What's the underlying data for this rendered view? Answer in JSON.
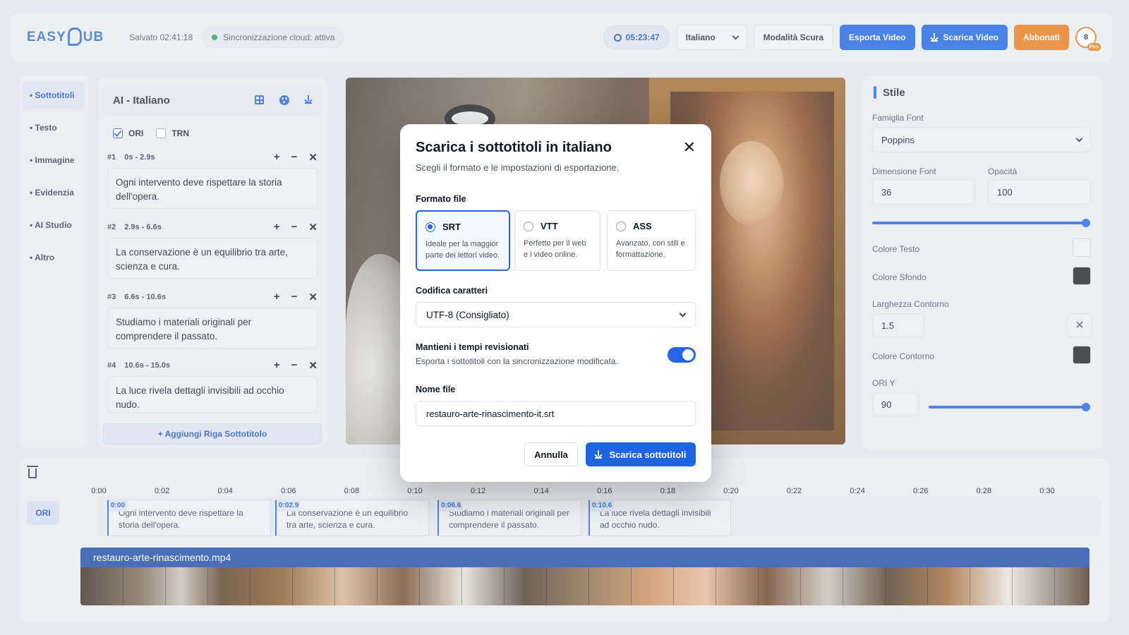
{
  "header": {
    "logo_left": "EASY",
    "logo_right": "UB",
    "saved": "Salvato 02:41:18",
    "cloud_status": "Sincronizzazione cloud: attiva",
    "timer": "05:23:47",
    "language": "Italiano",
    "dark_mode": "Modalità Scura",
    "export_video": "Esporta Video",
    "download_video": "Scarica Video",
    "subscribe": "Abbonati",
    "avatar_count": "8",
    "avatar_badge": "Pro"
  },
  "nav": {
    "items": [
      {
        "label": "• Sottotitoli"
      },
      {
        "label": "• Testo"
      },
      {
        "label": "• Immagine"
      },
      {
        "label": "• Evidenzia"
      },
      {
        "label": "• AI Studio"
      },
      {
        "label": "• Altro"
      }
    ]
  },
  "subtitles": {
    "title": "AI - Italiano",
    "ori_label": "ORI",
    "trn_label": "TRN",
    "cues": [
      {
        "num": "#1",
        "range": "0s - 2.9s",
        "text": "Ogni intervento deve rispettare la storia dell'opera."
      },
      {
        "num": "#2",
        "range": "2.9s - 6.6s",
        "text": "La conservazione è un equilibrio tra arte, scienza e cura."
      },
      {
        "num": "#3",
        "range": "6.6s - 10.6s",
        "text": "Studiamo i materiali originali per comprendere il passato."
      },
      {
        "num": "#4",
        "range": "10.6s - 15.0s",
        "text": "La luce rivela dettagli invisibili ad occhio nudo."
      }
    ],
    "add_row": "+ Aggiungi Riga Sottotitolo",
    "ctrl_plus": "+",
    "ctrl_minus": "−",
    "ctrl_close": "✕"
  },
  "style_panel": {
    "title": "Stile",
    "font_family_label": "Famiglia Font",
    "font_family": "Poppins",
    "font_size_label": "Dimensione Font",
    "font_size": "36",
    "opacity_label": "Opacità",
    "opacity": "100",
    "text_color_label": "Colore Testo",
    "bg_color_label": "Colore Sfondo",
    "outline_width_label": "Larghezza Contorno",
    "outline_width": "1.5",
    "outline_color_label": "Colore Contorno",
    "ori_y_label": "ORI Y",
    "ori_y": "90",
    "text_color": "#f3f4f6",
    "bg_color": "#1f1f1f",
    "outline_color": "#1f1f1f"
  },
  "timeline": {
    "ticks": [
      "0:00",
      "0:02",
      "0:04",
      "0:06",
      "0:08",
      "0:10",
      "0:12",
      "0:14",
      "0:16",
      "0:18",
      "0:20",
      "0:22",
      "0:24",
      "0:26",
      "0:28",
      "0:30"
    ],
    "track_label": "ORI",
    "segments": [
      {
        "start": "0:00",
        "text": "Ogni intervento deve rispettare la storia dell'opera."
      },
      {
        "start": "0:02.9",
        "text": "La conservazione è un equilibrio tra arte, scienza e cura."
      },
      {
        "start": "0:06.6",
        "text": "Studiamo i materiali originali per comprendere il passato."
      },
      {
        "start": "0:10.6",
        "text": "La luce rivela dettagli invisibili ad occhio nudo."
      }
    ],
    "video_file": "restauro-arte-rinascimento.mp4"
  },
  "modal": {
    "title": "Scarica i sottotitoli in italiano",
    "subtitle": "Scegli il formato e le impostazioni di esportazione.",
    "format_label": "Formato file",
    "formats": [
      {
        "name": "SRT",
        "desc": "Ideale per la maggior parte dei lettori video."
      },
      {
        "name": "VTT",
        "desc": "Perfetto per il web e i video online."
      },
      {
        "name": "ASS",
        "desc": "Avanzato, con stili e formattazione."
      }
    ],
    "encoding_label": "Codifica caratteri",
    "encoding": "UTF-8 (Consigliato)",
    "keep_timing_label": "Mantieni i tempi revisionati",
    "keep_timing_desc": "Esporta i sottotitoli con la sincronizzazione modificata.",
    "filename_label": "Nome file",
    "filename": "restauro-arte-rinascimento-it.srt",
    "cancel": "Annulla",
    "download": "Scarica sottotitoli",
    "close": "✕"
  },
  "colors": {
    "accent": "#1e63e0",
    "orange": "#ea7a1d",
    "track_blue": "#1e4aa8"
  }
}
